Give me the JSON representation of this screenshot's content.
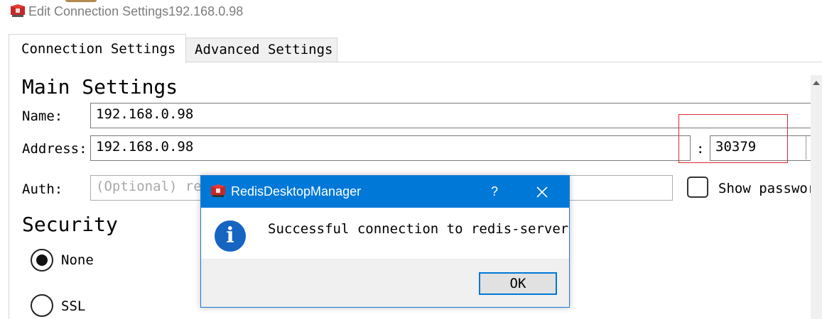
{
  "window": {
    "title": "Edit Connection Settings192.168.0.98",
    "app_icon": "redis-cube-icon"
  },
  "tabs": [
    {
      "label": "Connection Settings",
      "active": true
    },
    {
      "label": "Advanced Settings",
      "active": false
    }
  ],
  "main_settings": {
    "heading": "Main Settings",
    "name_label": "Name:",
    "name_value": "192.168.0.98",
    "address_label": "Address:",
    "address_value": "192.168.0.98",
    "port_separator": ":",
    "port_value": "30379",
    "auth_label": "Auth:",
    "auth_placeholder": "(Optional) redis-server authentication password",
    "show_password_label": "Show password",
    "show_password_checked": false
  },
  "security": {
    "heading": "Security",
    "options": [
      {
        "label": "None",
        "selected": true
      },
      {
        "label": "SSL",
        "selected": false
      }
    ]
  },
  "dialog": {
    "title": "RedisDesktopManager",
    "help_label": "?",
    "message": "Successful connection to redis-server",
    "ok_label": "OK",
    "icon": "info-icon"
  },
  "colors": {
    "dialog_title_bar": "#0078d7",
    "highlight_box": "#e1242d",
    "info_icon": "#1665c1"
  }
}
